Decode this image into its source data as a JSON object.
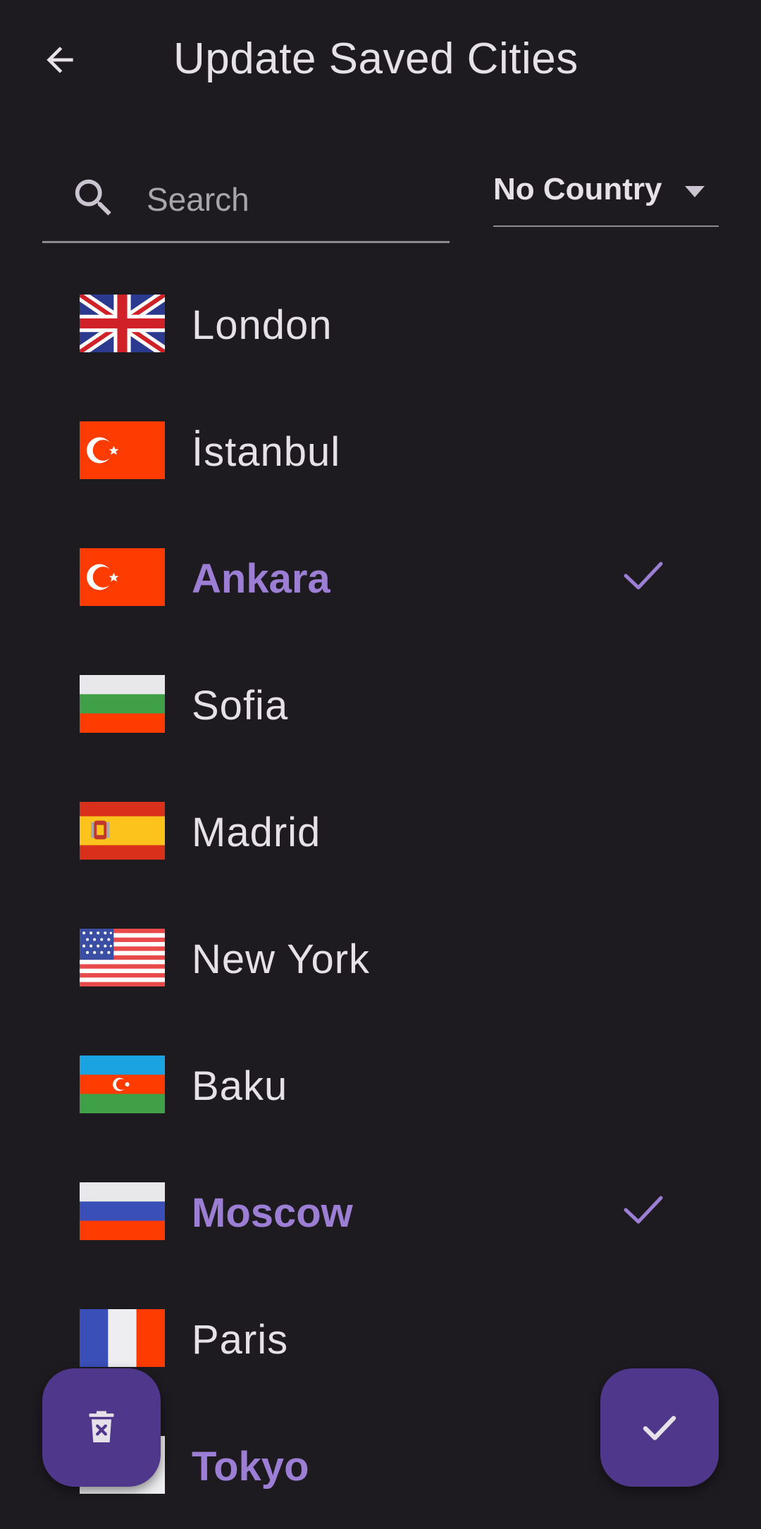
{
  "header": {
    "title": "Update Saved Cities",
    "back_icon": "arrow-back-icon"
  },
  "search": {
    "placeholder": "Search",
    "value": "",
    "icon": "search-icon"
  },
  "country_filter": {
    "selected": "No Country",
    "icon": "dropdown-arrow-icon"
  },
  "cities": [
    {
      "name": "London",
      "flag": "uk-flag-icon",
      "selected": false
    },
    {
      "name": "İstanbul",
      "flag": "turkey-flag-icon",
      "selected": false
    },
    {
      "name": "Ankara",
      "flag": "turkey-flag-icon",
      "selected": true
    },
    {
      "name": "Sofia",
      "flag": "bulgaria-flag-icon",
      "selected": false
    },
    {
      "name": "Madrid",
      "flag": "spain-flag-icon",
      "selected": false
    },
    {
      "name": "New York",
      "flag": "usa-flag-icon",
      "selected": false
    },
    {
      "name": "Baku",
      "flag": "azerbaijan-flag-icon",
      "selected": false
    },
    {
      "name": "Moscow",
      "flag": "russia-flag-icon",
      "selected": true
    },
    {
      "name": "Paris",
      "flag": "france-flag-icon",
      "selected": false
    },
    {
      "name": "Tokyo",
      "flag": "japan-flag-icon",
      "selected": true
    }
  ],
  "fabs": {
    "delete_icon": "delete-icon",
    "confirm_icon": "check-icon"
  },
  "colors": {
    "background": "#1d1b20",
    "selected_text": "#9c7fd4",
    "fab": "#4f378b",
    "text": "#e6e0e9"
  }
}
